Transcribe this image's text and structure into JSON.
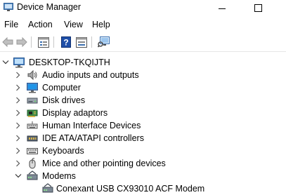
{
  "window": {
    "title": "Device Manager",
    "minimize_glyph": "—",
    "maximize_glyph": "☐"
  },
  "menu": [
    {
      "label": "File"
    },
    {
      "label": "Action"
    },
    {
      "label": "View"
    },
    {
      "label": "Help"
    }
  ],
  "toolbar": {
    "buttons": [
      "back-arrow-icon",
      "forward-arrow-icon",
      "properties-icon",
      "help-icon",
      "update-driver-icon",
      "scan-hardware-icon"
    ]
  },
  "tree": {
    "root": {
      "label": "DESKTOP-TKQIJTH",
      "expanded": true
    },
    "items": [
      {
        "label": "Audio inputs and outputs",
        "icon": "speaker-icon",
        "expanded": false
      },
      {
        "label": "Computer",
        "icon": "monitor-icon",
        "expanded": false
      },
      {
        "label": "Disk drives",
        "icon": "disk-drive-icon",
        "expanded": false
      },
      {
        "label": "Display adaptors",
        "icon": "display-adapter-icon",
        "expanded": false
      },
      {
        "label": "Human Interface Devices",
        "icon": "keyboard-hid-icon",
        "expanded": false
      },
      {
        "label": "IDE ATA/ATAPI controllers",
        "icon": "ide-controller-icon",
        "expanded": false
      },
      {
        "label": "Keyboards",
        "icon": "keyboard-icon",
        "expanded": false
      },
      {
        "label": "Mice and other pointing devices",
        "icon": "mouse-icon",
        "expanded": false
      },
      {
        "label": "Modems",
        "icon": "modem-icon",
        "expanded": true
      }
    ],
    "modem_child": {
      "label": "Conexant USB CX93010 ACF Modem",
      "icon": "modem-icon"
    }
  }
}
